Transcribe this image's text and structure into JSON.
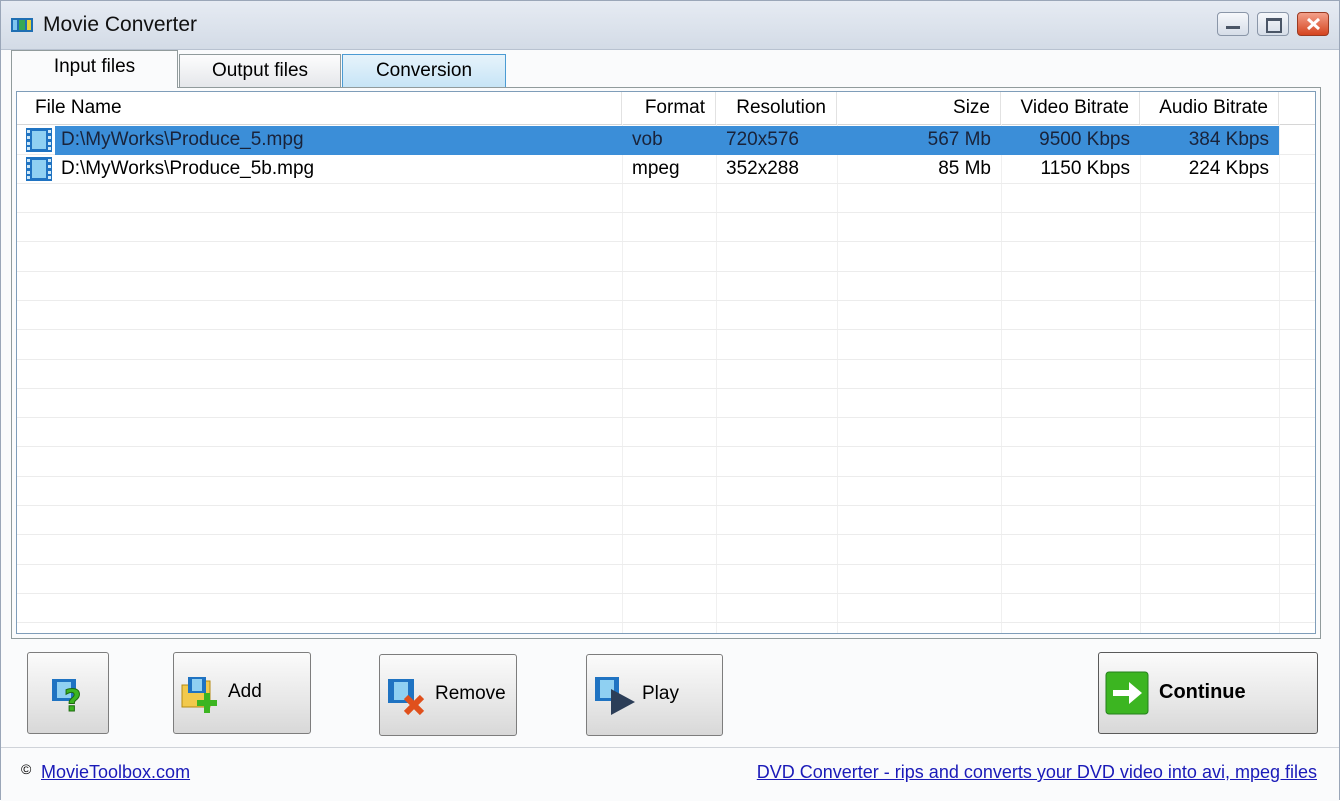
{
  "window": {
    "title": "Movie Converter"
  },
  "tabs": [
    {
      "label": "Input files"
    },
    {
      "label": "Output files"
    },
    {
      "label": "Conversion"
    }
  ],
  "table": {
    "columns": [
      "File Name",
      "Format",
      "Resolution",
      "Size",
      "Video Bitrate",
      "Audio Bitrate"
    ],
    "rows": [
      {
        "file": "D:\\MyWorks\\Produce_5.mpg",
        "format": "vob",
        "resolution": "720x576",
        "size": "567 Mb",
        "video": "9500 Kbps",
        "audio": "384 Kbps",
        "selected": true
      },
      {
        "file": "D:\\MyWorks\\Produce_5b.mpg",
        "format": "mpeg",
        "resolution": "352x288",
        "size": "85 Mb",
        "video": "1150 Kbps",
        "audio": "224 Kbps",
        "selected": false
      }
    ]
  },
  "buttons": {
    "add": "Add",
    "remove": "Remove",
    "play": "Play",
    "continue": "Continue"
  },
  "footer": {
    "copyright": "©",
    "site_link": "MovieToolbox.com",
    "promo_link": "DVD Converter - rips and converts your DVD video into avi, mpeg files"
  },
  "colors": {
    "selection": "#3b8ed8",
    "link": "#1a1ab8",
    "continue_arrow": "#3cb521"
  }
}
